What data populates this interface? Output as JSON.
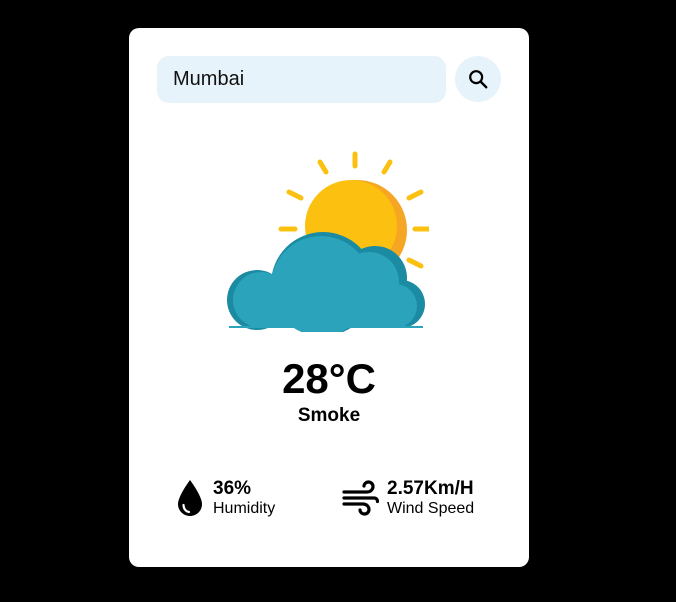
{
  "search": {
    "value": "Mumbai"
  },
  "weather": {
    "icon": "partly-cloudy-icon",
    "temperature": "28°C",
    "condition": "Smoke"
  },
  "details": {
    "humidity": {
      "value": "36%",
      "label": "Humidity",
      "icon": "humidity-drop-icon"
    },
    "wind": {
      "value": "2.57Km/H",
      "label": "Wind Speed",
      "icon": "wind-icon"
    }
  },
  "colors": {
    "background": "#000000",
    "card": "#ffffff",
    "input_bg": "#e6f3fa",
    "sun": "#fcc010",
    "sun_shade": "#f5a623",
    "cloud": "#2aa3bb",
    "cloud_shade": "#1b8aa3"
  }
}
